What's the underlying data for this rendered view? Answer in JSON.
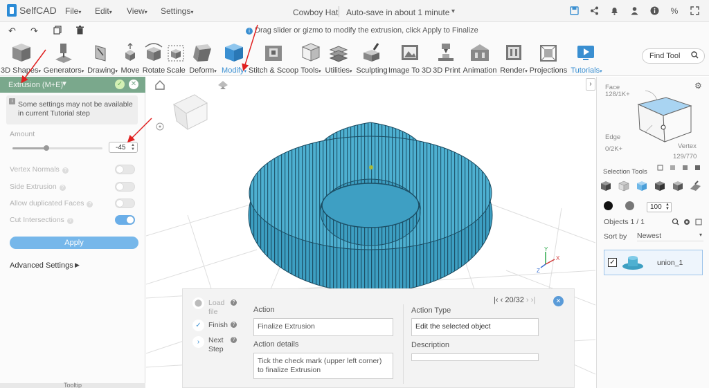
{
  "app": {
    "name": "SelfCAD"
  },
  "menu": {
    "file": "File",
    "edit": "Edit",
    "view": "View",
    "settings": "Settings"
  },
  "document": {
    "title": "Cowboy Hat",
    "status": "Auto-save in about 1 minute"
  },
  "hint": "Drag slider or gizmo to modify the extrusion, click Apply to Finalize",
  "toolbar": {
    "tools": [
      "3D Shapes",
      "Generators",
      "Drawing",
      "Move",
      "Rotate",
      "Scale",
      "Deform",
      "Modify",
      "Stitch & Scoop",
      "Tools",
      "Utilities",
      "Sculpting",
      "Image To 3D",
      "3D Print",
      "Animation",
      "Render",
      "Projections",
      "Tutorials"
    ],
    "find_tool": "Find Tool"
  },
  "left_panel": {
    "title": "Extrusion (M+E)",
    "notice": "Some settings may not be available in current Tutorial step",
    "amount_label": "Amount",
    "amount_value": "-45",
    "amount_slider_fraction": 0.38,
    "options": [
      {
        "label": "Vertex Normals",
        "on": false
      },
      {
        "label": "Side Extrusion",
        "on": false
      },
      {
        "label": "Allow duplicated Faces",
        "on": false
      },
      {
        "label": "Cut Intersections",
        "on": true
      }
    ],
    "apply": "Apply",
    "advanced": "Advanced Settings",
    "tooltip": "Tooltip"
  },
  "tutorial": {
    "steps": [
      {
        "label": "Load file"
      },
      {
        "label": "Finish"
      },
      {
        "label": "Next Step"
      }
    ],
    "nav": "20/32",
    "action_label": "Action",
    "action_value": "Finalize Extrusion",
    "action_details_label": "Action details",
    "action_details_value": "Tick the check mark (upper left corner) to finalize Extrusion",
    "action_type_label": "Action Type",
    "action_type_value": "Edit the selected object",
    "description_label": "Description",
    "description_value": ""
  },
  "right_panel": {
    "face_label": "Face",
    "face_count": "128/1K+",
    "edge_label": "Edge",
    "edge_count": "0/2K+",
    "vertex_label": "Vertex",
    "vertex_count": "129/770",
    "selection_tools": "Selection Tools",
    "size_value": "100",
    "objects_label": "Objects 1 / 1",
    "sort_label": "Sort by",
    "sort_value": "Newest",
    "objects": [
      {
        "name": "union_1",
        "checked": true
      }
    ]
  },
  "colors": {
    "accent": "#3a8fd1",
    "panel_header": "#7aa88c",
    "apply": "#76b7ea",
    "model": "#2f8fb0"
  }
}
